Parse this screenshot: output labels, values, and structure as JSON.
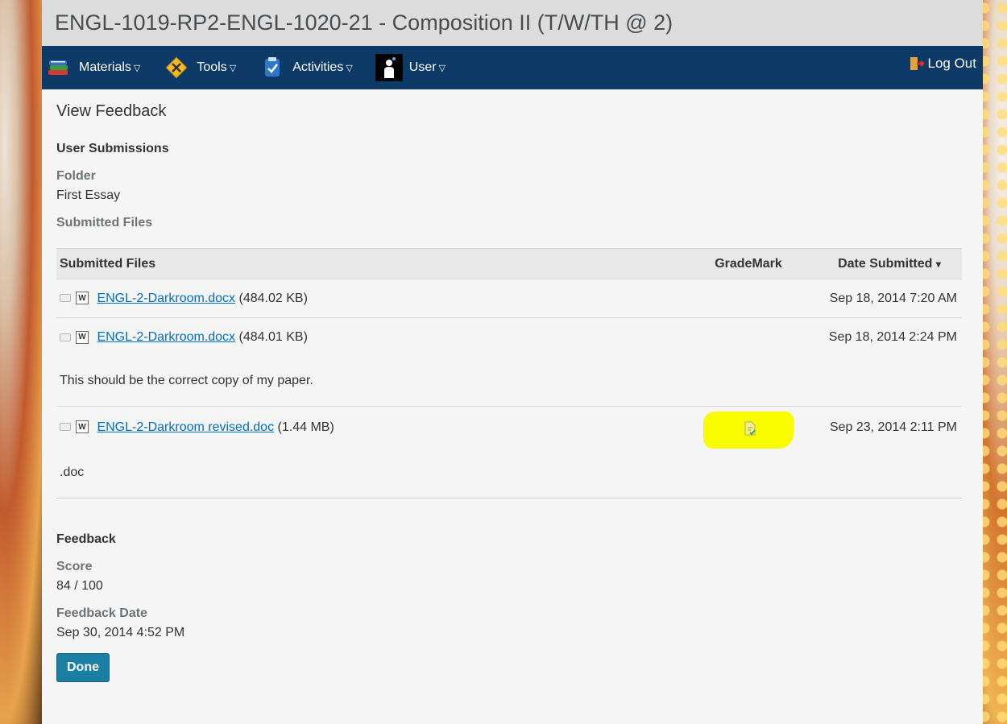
{
  "course": {
    "title": "ENGL-1019-RP2-ENGL-1020-21 - Composition II (T/W/TH @ 2)"
  },
  "nav": {
    "items": [
      {
        "label": "Materials",
        "icon": "books-icon"
      },
      {
        "label": "Tools",
        "icon": "tools-icon"
      },
      {
        "label": "Activities",
        "icon": "clipboard-icon"
      },
      {
        "label": "User",
        "icon": "user-icon"
      }
    ],
    "logout_label": "Log Out",
    "caret": "▽"
  },
  "page": {
    "title": "View Feedback"
  },
  "submissions": {
    "heading": "User Submissions",
    "folder_label": "Folder",
    "folder_value": "First Essay",
    "files_label": "Submitted Files",
    "table": {
      "headers": {
        "files": "Submitted Files",
        "grademark": "GradeMark",
        "date": "Date Submitted"
      },
      "sort_indicator": "▾",
      "rows": [
        {
          "name": "ENGL-2-Darkroom.docx",
          "size": "(484.02 KB)",
          "date": "Sep 18, 2014 7:20 AM",
          "comment": ""
        },
        {
          "name": "ENGL-2-Darkroom.docx",
          "size": "(484.01 KB)",
          "date": "Sep 18, 2014 2:24 PM",
          "comment": "This should be the correct copy of my paper."
        },
        {
          "name": "ENGL-2-Darkroom revised.doc",
          "size": "(1.44 MB)",
          "date": "Sep 23, 2014 2:11 PM",
          "comment": ".doc"
        }
      ]
    }
  },
  "feedback": {
    "heading": "Feedback",
    "score_label": "Score",
    "score_value": "84 / 100",
    "date_label": "Feedback Date",
    "date_value": "Sep 30, 2014 4:52 PM"
  },
  "actions": {
    "done_label": "Done"
  },
  "colors": {
    "nav_bg": "#0e3a68",
    "link": "#006fbf",
    "done_bg": "#1a7fa3",
    "highlight": "#f9fb00"
  }
}
